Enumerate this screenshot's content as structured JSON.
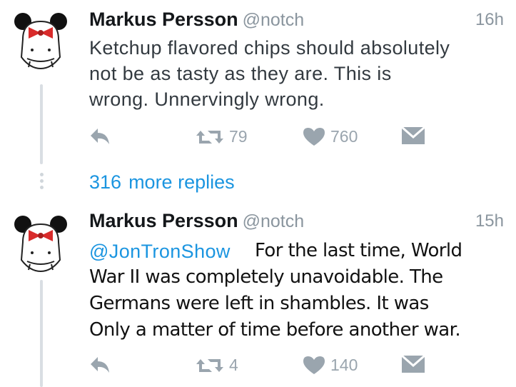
{
  "tweets": [
    {
      "author_name": "Markus Persson",
      "handle": "@notch",
      "time": "16h",
      "text_lines": [
        "Ketchup flavored chips should absolutely",
        "not be as tasty as they are. This is",
        "wrong. Unnervingly wrong."
      ],
      "retweets": "79",
      "likes": "760"
    },
    {
      "author_name": "Markus Persson",
      "handle": "@notch",
      "time": "15h",
      "mention": "@JonTronShow",
      "overlay_lines": [
        "For the last time, World",
        "War II was completely unavoidable. The",
        "Germans were left in shambles. It was",
        "Only a matter of time before another war."
      ],
      "retweets": "4",
      "likes": "140"
    }
  ],
  "more_replies": {
    "count": "316",
    "label": "more replies"
  },
  "icons": {
    "reply": "reply-icon",
    "retweet": "retweet-icon",
    "like": "heart-icon",
    "dm": "envelope-icon"
  },
  "colors": {
    "link": "#1b95e0",
    "muted": "#9aa5ae",
    "thread_line": "#d9dee3"
  }
}
